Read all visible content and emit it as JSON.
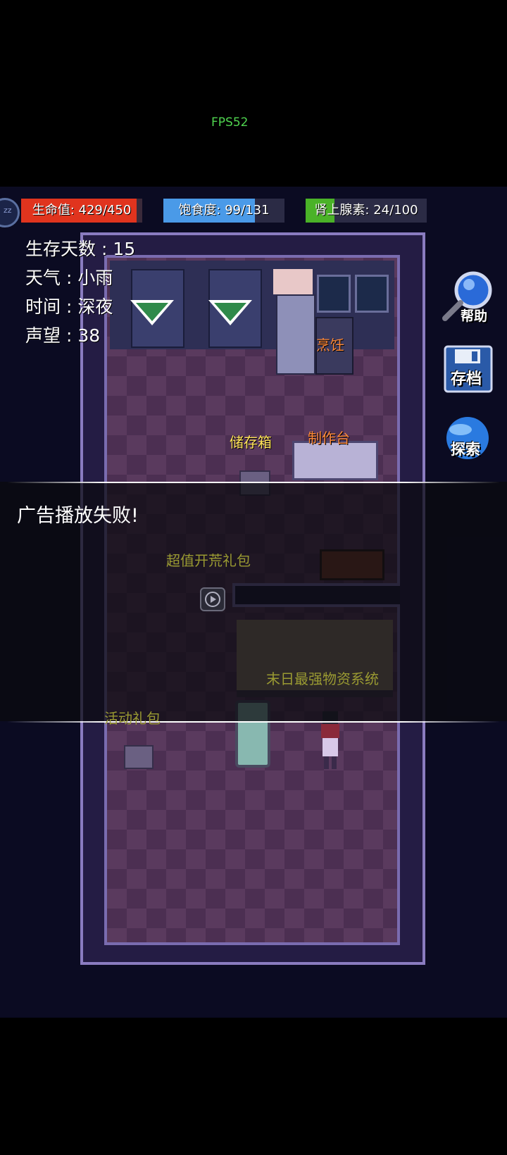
{
  "fps": "FPS52",
  "status": {
    "hp": {
      "label": "生命值: 429/450",
      "fraction": 0.953,
      "color": "#e0341e",
      "bg": "#3a2a3a"
    },
    "food": {
      "label": "饱食度: 99/131",
      "fraction": 0.756,
      "color": "#4a9ae8",
      "bg": "#2b2b45"
    },
    "adrenaline": {
      "label": "肾上腺素: 24/100",
      "fraction": 0.24,
      "color": "#4ab228",
      "bg": "#2b2b45"
    }
  },
  "stats": {
    "days": "生存天数 : 15",
    "weather": "天气 : 小雨",
    "time": "时间 : 深夜",
    "reputation": "声望 : 38"
  },
  "world_labels": {
    "cook": "烹饪",
    "storage": "储存箱",
    "workbench": "制作台"
  },
  "buttons": {
    "help": "帮助",
    "save": "存档",
    "explore": "探索"
  },
  "toast": {
    "message": "广告播放失败!",
    "ghost_pack": "超值开荒礼包",
    "ghost_system": "末日最强物资系统",
    "ghost_event": "活动礼包"
  },
  "avatar_text": "zz"
}
